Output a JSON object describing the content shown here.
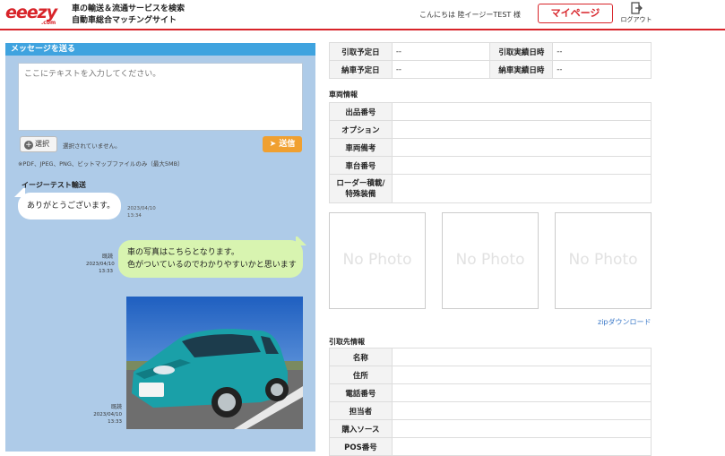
{
  "header": {
    "logo_text": "eeezy",
    "logo_sub": ".com",
    "tagline_line1": "車の輸送＆流通サービスを検索",
    "tagline_line2": "自動車総合マッチングサイト",
    "greeting": "こんにちは 陸イージーTEST 様",
    "mypage_label": "マイページ",
    "logout_label": "ログアウト"
  },
  "message_panel": {
    "title": "メッセージを送る",
    "textarea_placeholder": "ここにテキストを入力してください。",
    "select_label": "選択",
    "no_file_text": "選択されていません。",
    "send_label": "送信",
    "file_note": "※PDF、JPEG、PNG、ビットマップファイルのみ（最大5MB）",
    "messages": [
      {
        "sender": "イージーテスト輸送",
        "text": "ありがとうございます。",
        "date": "2023/04/10",
        "time": "13:34"
      },
      {
        "read": "既読",
        "line1": "車の写真はこちらとなります。",
        "line2": "色がついているのでわかりやすいかと思います",
        "date": "2023/04/10",
        "time": "13:33"
      },
      {
        "read": "既読",
        "date": "2023/04/10",
        "time": "13:33"
      }
    ]
  },
  "dates": {
    "planned_pickup_label": "引取予定日",
    "planned_pickup_value": "--",
    "actual_pickup_label": "引取実績日時",
    "actual_pickup_value": "--",
    "planned_delivery_label": "納車予定日",
    "planned_delivery_value": "--",
    "actual_delivery_label": "納車実績日時",
    "actual_delivery_value": "--"
  },
  "vehicle": {
    "section_title": "車両情報",
    "rows": [
      "出品番号",
      "オプション",
      "車両備考",
      "車台番号",
      "ローダー積載/",
      "特殊装備"
    ]
  },
  "photos": {
    "placeholder": "No Photo",
    "zip_link": "zipダウンロード"
  },
  "destination": {
    "section_title": "引取先情報",
    "rows": [
      "名称",
      "住所",
      "電話番号",
      "担当者",
      "購入ソース",
      "POS番号"
    ]
  }
}
